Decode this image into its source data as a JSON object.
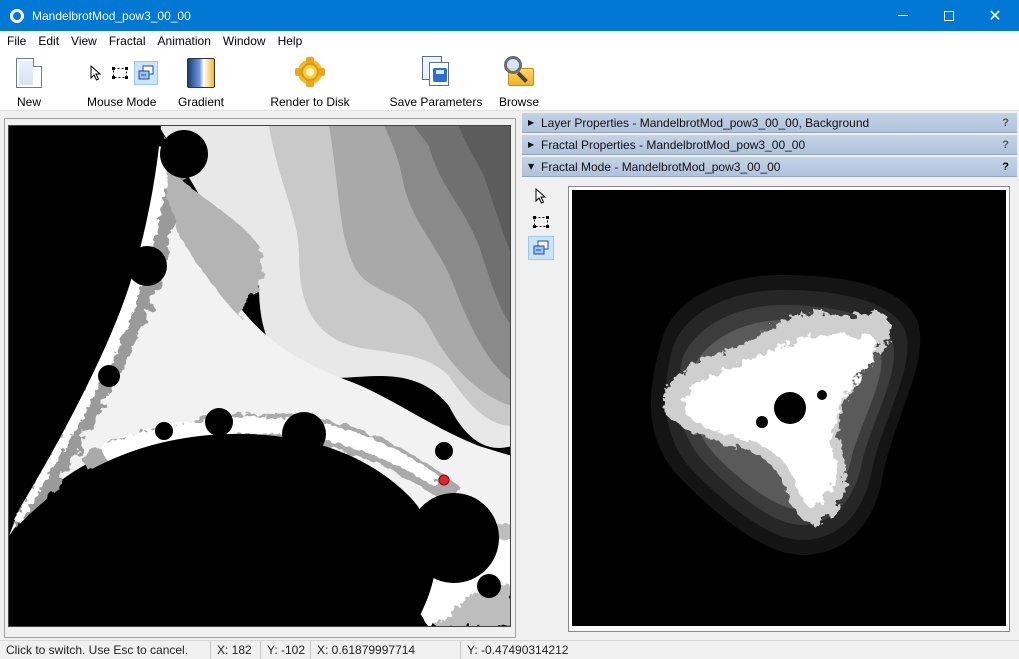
{
  "window": {
    "title": "MandelbrotMod_pow3_00_00",
    "controls": {
      "minimize": "minimize",
      "maximize": "maximize",
      "close": "close"
    }
  },
  "menu": {
    "items": [
      "File",
      "Edit",
      "View",
      "Fractal",
      "Animation",
      "Window",
      "Help"
    ]
  },
  "toolbar": {
    "new_label": "New",
    "mouse_mode_label": "Mouse Mode",
    "gradient_label": "Gradient",
    "render_label": "Render to Disk",
    "save_params_label": "Save Parameters",
    "browse_label": "Browse",
    "mouse_modes": [
      {
        "icon": "pointer-icon",
        "active": false
      },
      {
        "icon": "select-region-icon",
        "active": false
      },
      {
        "icon": "switch-mode-icon",
        "active": true
      }
    ]
  },
  "panels": {
    "layer_properties": {
      "title": "Layer Properties - MandelbrotMod_pow3_00_00, Background",
      "expanded": false,
      "help": "?"
    },
    "fractal_properties": {
      "title": "Fractal Properties - MandelbrotMod_pow3_00_00",
      "expanded": false,
      "help": "?"
    },
    "fractal_mode": {
      "title": "Fractal Mode - MandelbrotMod_pow3_00_00",
      "expanded": true,
      "help": "?"
    }
  },
  "status": {
    "hint": "Click to switch. Use Esc to cancel.",
    "x_pixel": "X: 182",
    "y_pixel": "Y: -102",
    "x_coord": "X: 0.61879997714",
    "y_coord": "Y: -0.47490314212"
  },
  "colors": {
    "titlebar": "#0078d4",
    "panel_header": "#b8c8de",
    "active_tool": "#cce4f7",
    "marker": "#e0242c"
  }
}
